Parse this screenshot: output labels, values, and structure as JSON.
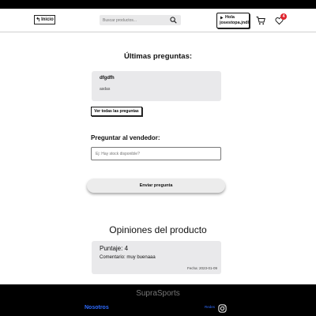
{
  "header": {
    "back_label": "Inicio",
    "search_placeholder": "Buscar productos...",
    "user_greeting": "Hola",
    "user_name": "josestopa.jndl",
    "cart_count": "4"
  },
  "questions": {
    "title": "Últimas preguntas:",
    "items": [
      {
        "question": "dfgdfh",
        "answer": "asdas"
      }
    ],
    "see_all_label": "Ver todas las preguntas"
  },
  "ask": {
    "label": "Preguntar al vendedor:",
    "placeholder": "Ej: Hay stock disponible?",
    "send_label": "Enviar pregunta"
  },
  "reviews": {
    "title": "Opiniones del producto",
    "items": [
      {
        "score": "Puntaje: 4",
        "comment": "Comentario: muy buenaaa",
        "date": "Fecha: 2023-01-09"
      }
    ]
  },
  "footer": {
    "brand": "SupraSports",
    "about_label": "Nosotros",
    "social_label": "Redes"
  },
  "colors": {
    "accent_link": "#2e6bff",
    "badge": "#e0242e",
    "card_bg": "#e9e9eb"
  }
}
